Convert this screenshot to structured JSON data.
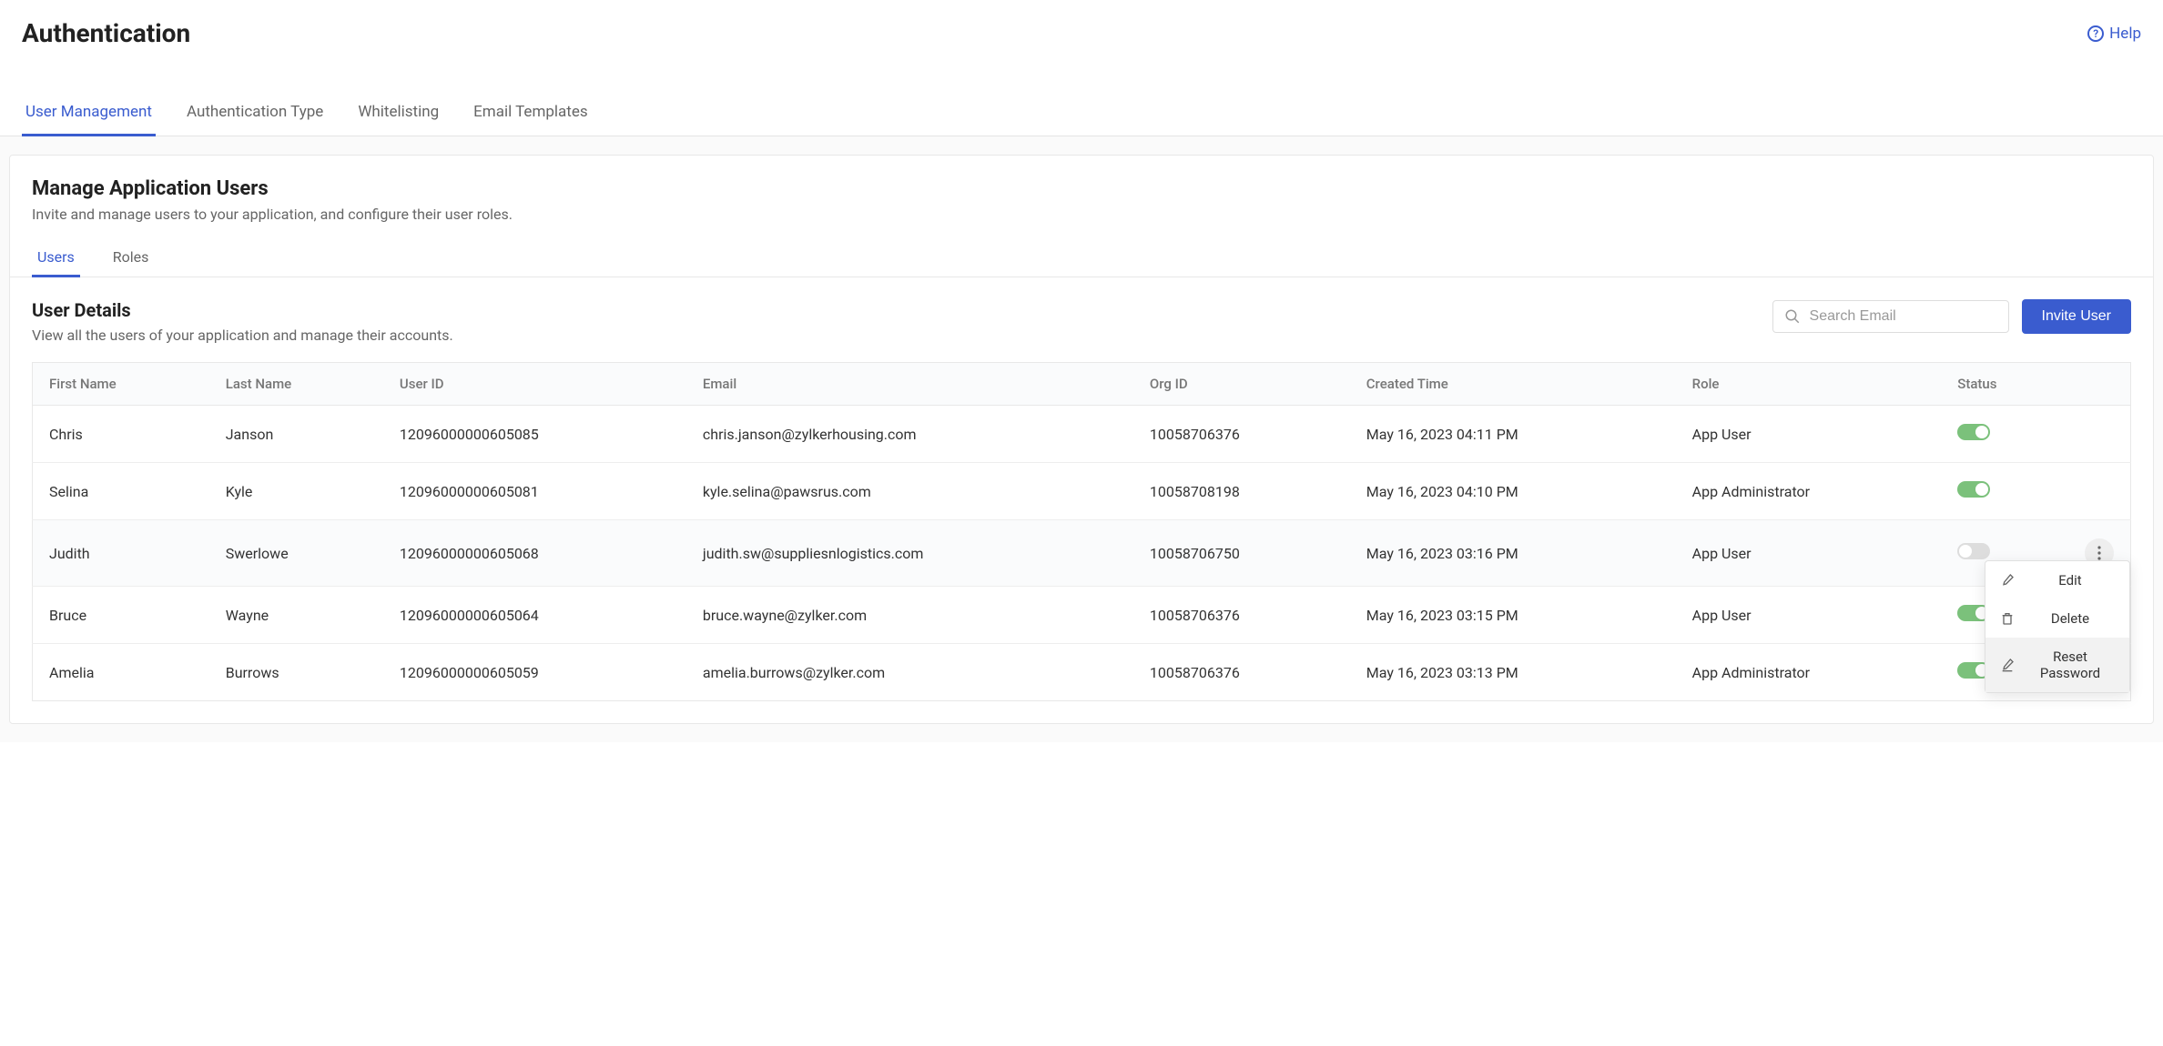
{
  "page": {
    "title": "Authentication",
    "help_label": "Help"
  },
  "main_tabs": [
    {
      "label": "User Management",
      "active": true
    },
    {
      "label": "Authentication Type",
      "active": false
    },
    {
      "label": "Whitelisting",
      "active": false
    },
    {
      "label": "Email Templates",
      "active": false
    }
  ],
  "section": {
    "title": "Manage Application Users",
    "subtitle": "Invite and manage users to your application, and configure their user roles."
  },
  "sub_tabs": [
    {
      "label": "Users",
      "active": true
    },
    {
      "label": "Roles",
      "active": false
    }
  ],
  "details": {
    "title": "User Details",
    "subtitle": "View all the users of your application and manage their accounts."
  },
  "search": {
    "placeholder": "Search Email"
  },
  "invite_button_label": "Invite User",
  "table": {
    "headers": [
      "First Name",
      "Last Name",
      "User ID",
      "Email",
      "Org ID",
      "Created Time",
      "Role",
      "Status"
    ],
    "rows": [
      {
        "first_name": "Chris",
        "last_name": "Janson",
        "user_id": "12096000000605085",
        "email": "chris.janson@zylkerhousing.com",
        "org_id": "10058706376",
        "created": "May 16, 2023 04:11 PM",
        "role": "App User",
        "status_on": true,
        "hovered": false,
        "show_menu": false
      },
      {
        "first_name": "Selina",
        "last_name": "Kyle",
        "user_id": "12096000000605081",
        "email": "kyle.selina@pawsrus.com",
        "org_id": "10058708198",
        "created": "May 16, 2023 04:10 PM",
        "role": "App Administrator",
        "status_on": true,
        "hovered": false,
        "show_menu": false
      },
      {
        "first_name": "Judith",
        "last_name": "Swerlowe",
        "user_id": "12096000000605068",
        "email": "judith.sw@suppliesnlogistics.com",
        "org_id": "10058706750",
        "created": "May 16, 2023 03:16 PM",
        "role": "App User",
        "status_on": false,
        "hovered": true,
        "show_menu": true
      },
      {
        "first_name": "Bruce",
        "last_name": "Wayne",
        "user_id": "12096000000605064",
        "email": "bruce.wayne@zylker.com",
        "org_id": "10058706376",
        "created": "May 16, 2023 03:15 PM",
        "role": "App User",
        "status_on": true,
        "hovered": false,
        "show_menu": false
      },
      {
        "first_name": "Amelia",
        "last_name": "Burrows",
        "user_id": "12096000000605059",
        "email": "amelia.burrows@zylker.com",
        "org_id": "10058706376",
        "created": "May 16, 2023 03:13 PM",
        "role": "App Administrator",
        "status_on": true,
        "hovered": false,
        "show_menu": false
      }
    ]
  },
  "row_menu": {
    "items": [
      {
        "label": "Edit",
        "icon": "edit",
        "highlighted": false
      },
      {
        "label": "Delete",
        "icon": "trash",
        "highlighted": false
      },
      {
        "label": "Reset Password",
        "icon": "edit-underline",
        "highlighted": true
      }
    ]
  }
}
